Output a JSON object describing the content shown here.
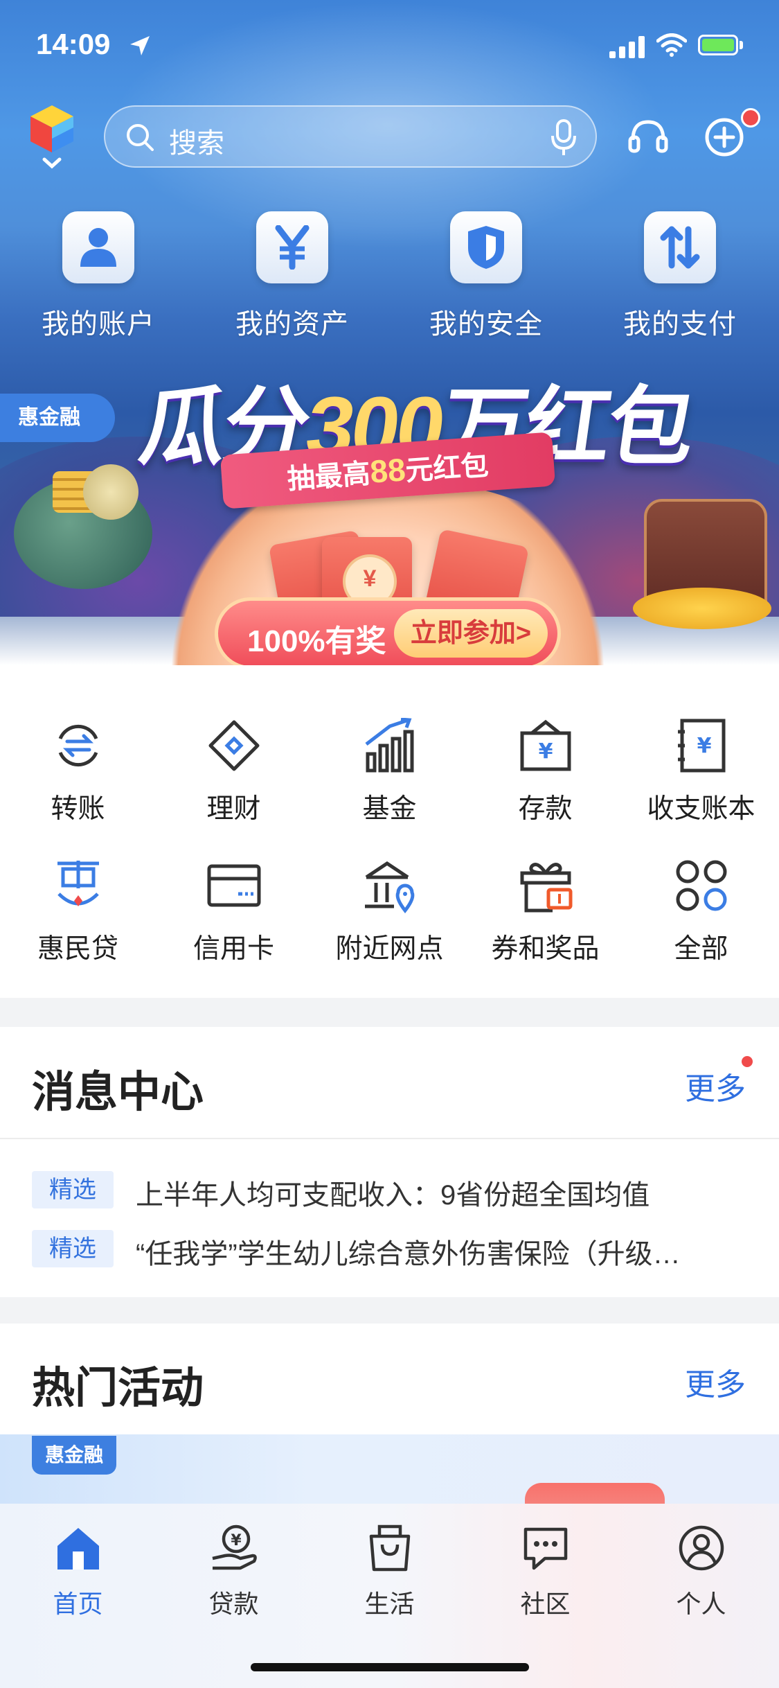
{
  "status": {
    "time": "14:09"
  },
  "header": {
    "search_placeholder": "搜索"
  },
  "quick_tiles": [
    {
      "label": "我的账户",
      "icon": "person-icon"
    },
    {
      "label": "我的资产",
      "icon": "yen-icon"
    },
    {
      "label": "我的安全",
      "icon": "shield-icon"
    },
    {
      "label": "我的支付",
      "icon": "transfer-arrows-icon"
    }
  ],
  "banner": {
    "tag": "惠金融",
    "title_a": "瓜分",
    "title_num": "300",
    "title_b": "万红包",
    "ribbon_a": "抽最高",
    "ribbon_num": "88",
    "ribbon_b": "元红包",
    "prize_text": "100%有奖",
    "join_button": "立即参加>"
  },
  "functions": [
    {
      "label": "转账",
      "icon": "transfer-icon"
    },
    {
      "label": "理财",
      "icon": "diamond-icon"
    },
    {
      "label": "基金",
      "icon": "bar-chart-icon"
    },
    {
      "label": "存款",
      "icon": "deposit-box-icon"
    },
    {
      "label": "收支账本",
      "icon": "ledger-icon"
    },
    {
      "label": "惠民贷",
      "icon": "huimin-loan-icon"
    },
    {
      "label": "信用卡",
      "icon": "credit-card-icon"
    },
    {
      "label": "附近网点",
      "icon": "bank-location-icon"
    },
    {
      "label": "券和奖品",
      "icon": "gift-icon"
    },
    {
      "label": "全部",
      "icon": "grid-icon"
    }
  ],
  "messages": {
    "title": "消息中心",
    "more": "更多",
    "items": [
      {
        "tag": "精选",
        "text": "上半年人均可支配收入：9省份超全国均值"
      },
      {
        "tag": "精选",
        "text": "“任我学”学生幼儿综合意外伤害保险（升级…"
      }
    ]
  },
  "activities": {
    "title": "热门活动",
    "more": "更多",
    "tag": "惠金融"
  },
  "tabs": [
    {
      "label": "首页",
      "icon": "home-icon",
      "active": true
    },
    {
      "label": "贷款",
      "icon": "loan-icon"
    },
    {
      "label": "生活",
      "icon": "shopping-bag-icon"
    },
    {
      "label": "社区",
      "icon": "chat-icon"
    },
    {
      "label": "个人",
      "icon": "profile-icon"
    }
  ],
  "colors": {
    "accent": "#2f6fe0",
    "badge": "#f04b4b"
  }
}
